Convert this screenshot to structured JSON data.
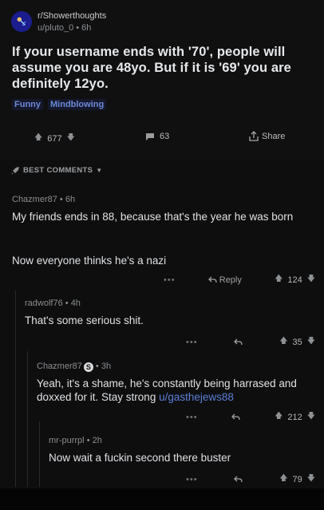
{
  "post": {
    "subreddit": "r/Showerthoughts",
    "author": "u/pluto_0",
    "age": "6h",
    "title": "If your username ends with '70', people will assume you are 48yo. But if it is '69' you are definitely 12yo.",
    "flairs": [
      "Funny",
      "Mindblowing"
    ],
    "score": "677",
    "comments": "63",
    "share_label": "Share"
  },
  "sort": {
    "label": "BEST COMMENTS"
  },
  "comments": [
    {
      "author": "Chazmer87",
      "age": "6h",
      "body1": "My friends ends in 88, because that's the year he was born",
      "body2": "Now everyone thinks he's a nazi",
      "reply_label": "Reply",
      "score": "124"
    },
    {
      "author": "radwolf76",
      "age": "4h",
      "body": "That's some serious shit.",
      "score": "35"
    },
    {
      "author": "Chazmer87",
      "op_badge": "S",
      "age": "3h",
      "body_text": "Yeah, it's a shame, he's constantly being harrased and doxxed for it. Stay strong ",
      "body_link": "u/gasthejews88",
      "score": "212"
    },
    {
      "author": "mr-purrpl",
      "age": "2h",
      "body": "Now wait a fuckin second there buster",
      "score": "79"
    }
  ],
  "ui": {
    "more": "•••",
    "dot": "•"
  },
  "colors": {
    "background": "#000000",
    "link": "#5b7ed6",
    "flair": "#6b8ad8"
  },
  "icons": [
    "subreddit-icon",
    "upvote-icon",
    "downvote-icon",
    "comment-icon",
    "share-icon",
    "rocket-icon",
    "chevron-down-icon",
    "reply-icon"
  ]
}
